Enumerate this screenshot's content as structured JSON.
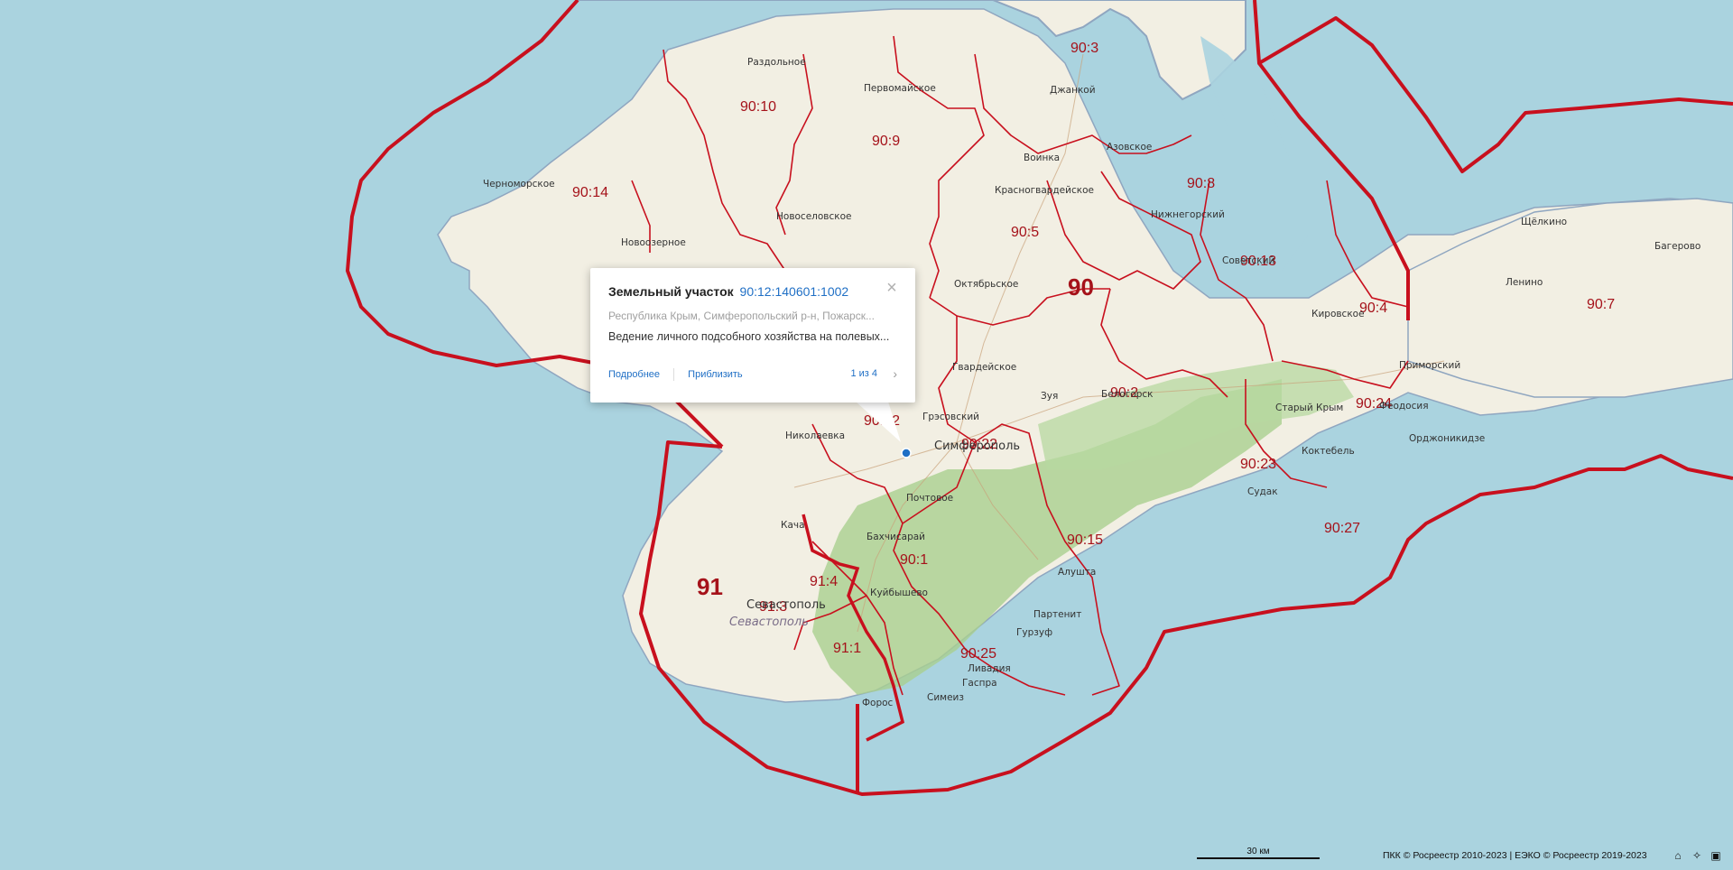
{
  "map": {
    "region_labels": [
      {
        "id": "r90",
        "text": "90"
      },
      {
        "id": "r91",
        "text": "91"
      },
      {
        "id": "d90_1",
        "text": "90:1"
      },
      {
        "id": "d90_2",
        "text": "90:2"
      },
      {
        "id": "d90_3",
        "text": "90:3"
      },
      {
        "id": "d90_4",
        "text": "90:4"
      },
      {
        "id": "d90_5",
        "text": "90:5"
      },
      {
        "id": "d90_7",
        "text": "90:7"
      },
      {
        "id": "d90_8",
        "text": "90:8"
      },
      {
        "id": "d90_9",
        "text": "90:9"
      },
      {
        "id": "d90_10",
        "text": "90:10"
      },
      {
        "id": "d90_12",
        "text": "90:12"
      },
      {
        "id": "d90_13",
        "text": "90:13"
      },
      {
        "id": "d90_14",
        "text": "90:14"
      },
      {
        "id": "d90_15",
        "text": "90:15"
      },
      {
        "id": "d90_22",
        "text": "90:22"
      },
      {
        "id": "d90_23",
        "text": "90:23"
      },
      {
        "id": "d90_24",
        "text": "90:24"
      },
      {
        "id": "d90_25",
        "text": "90:25"
      },
      {
        "id": "d90_27",
        "text": "90:27"
      },
      {
        "id": "d91_1",
        "text": "91:1"
      },
      {
        "id": "d91_3",
        "text": "91:3"
      },
      {
        "id": "d91_4",
        "text": "91:4"
      }
    ],
    "city_labels": [
      {
        "id": "razdolnoe",
        "text": "Раздольное"
      },
      {
        "id": "pervomayskoe",
        "text": "Первомайское"
      },
      {
        "id": "dzhankoy",
        "text": "Джанкой"
      },
      {
        "id": "azovskoe",
        "text": "Азовское"
      },
      {
        "id": "chernomorskoe",
        "text": "Черноморское"
      },
      {
        "id": "voinka",
        "text": "Воинка"
      },
      {
        "id": "novoselovskoe",
        "text": "Новоселовское"
      },
      {
        "id": "krasnogvardeyskoe",
        "text": "Красногвардейское"
      },
      {
        "id": "nizhnegorsky",
        "text": "Нижнегорский"
      },
      {
        "id": "novoozernoe",
        "text": "Новоозерное"
      },
      {
        "id": "sovetsky",
        "text": "Советский"
      },
      {
        "id": "shchelkino",
        "text": "Щёлкино"
      },
      {
        "id": "bagerovo",
        "text": "Багерово"
      },
      {
        "id": "oktyabrskoe",
        "text": "Октябрьское"
      },
      {
        "id": "lenino",
        "text": "Ленино"
      },
      {
        "id": "kirovskoe",
        "text": "Кировское"
      },
      {
        "id": "gvardeyskoe",
        "text": "Гвардейское"
      },
      {
        "id": "primorsky",
        "text": "Приморский"
      },
      {
        "id": "zuya",
        "text": "Зуя"
      },
      {
        "id": "belogorsk",
        "text": "Белогорск"
      },
      {
        "id": "stary_krym",
        "text": "Старый Крым"
      },
      {
        "id": "feodosiya",
        "text": "Феодосия"
      },
      {
        "id": "grvardeysky",
        "text": "Грэсовский"
      },
      {
        "id": "ordzhonikidze",
        "text": "Орджоникидзе"
      },
      {
        "id": "nikolaevka",
        "text": "Николаевка"
      },
      {
        "id": "simferopol",
        "text": "Симферополь"
      },
      {
        "id": "koktebel",
        "text": "Коктебель"
      },
      {
        "id": "pochtovoe",
        "text": "Почтовое"
      },
      {
        "id": "sudak",
        "text": "Судак"
      },
      {
        "id": "kacha",
        "text": "Кача"
      },
      {
        "id": "bakhchisaray",
        "text": "Бахчисарай"
      },
      {
        "id": "alushta",
        "text": "Алушта"
      },
      {
        "id": "kuybyshevo",
        "text": "Куйбышево"
      },
      {
        "id": "sevastopol",
        "text": "Севастополь"
      },
      {
        "id": "sevastopol_it",
        "text": "Севастополь"
      },
      {
        "id": "partenit",
        "text": "Партенит"
      },
      {
        "id": "gurzuf",
        "text": "Гурзуф"
      },
      {
        "id": "livadiya",
        "text": "Ливадия"
      },
      {
        "id": "gaspra",
        "text": "Гаспра"
      },
      {
        "id": "simeiz",
        "text": "Симеиз"
      },
      {
        "id": "foros",
        "text": "Форос"
      }
    ]
  },
  "popup": {
    "kind": "Земельный участок",
    "cadastral_number": "90:12:140601:1002",
    "address": "Республика Крым, Симферопольский р-н, Пожарск...",
    "usage": "Ведение личного подсобного хозяйства на полевых...",
    "details_label": "Подробнее",
    "zoom_label": "Приблизить",
    "pager": "1 из 4",
    "close_icon": "close-icon",
    "next_icon": "chevron-right-icon"
  },
  "scale": {
    "label": "30 км"
  },
  "copyright": "ПКК © Росреестр 2010-2023 | ЕЭКО © Росреестр 2019-2023",
  "controls": [
    {
      "name": "home-icon",
      "glyph": "⌂"
    },
    {
      "name": "locate-icon",
      "glyph": "✧"
    },
    {
      "name": "fullscreen-icon",
      "glyph": "▣"
    }
  ],
  "colors": {
    "sea": "#aad3df",
    "land": "#f2efe3",
    "forest": "#a9cf8f",
    "boundary": "#c8101e",
    "link": "#1f6fc5"
  }
}
